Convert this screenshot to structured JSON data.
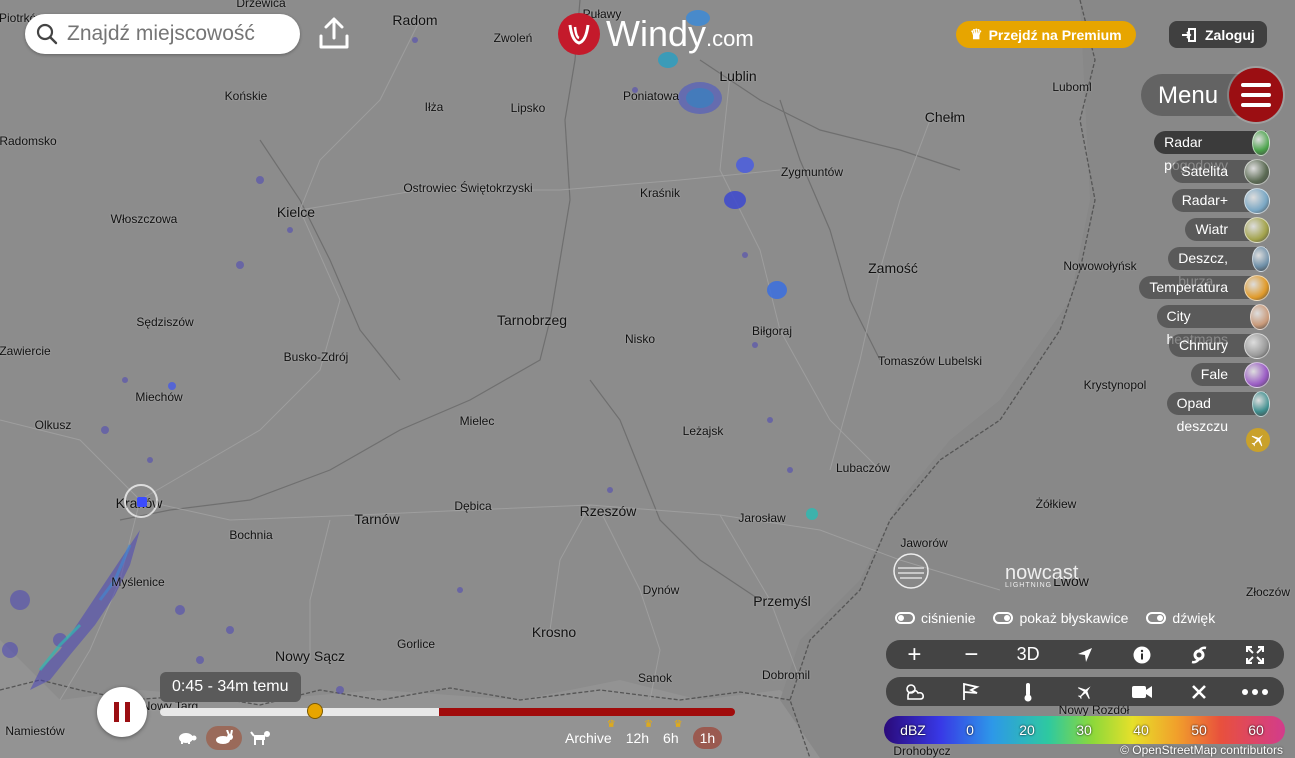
{
  "search": {
    "placeholder": "Znajdź miejscowość"
  },
  "logo": {
    "name": "Windy",
    "domain": ".com"
  },
  "header": {
    "premium_label": "Przejdź na Premium",
    "login_label": "Zaloguj"
  },
  "menu": {
    "label": "Menu"
  },
  "layers": [
    {
      "label": "Radar pogodowy",
      "active": true,
      "color": "#4aa34a"
    },
    {
      "label": "Satelita",
      "active": false,
      "color": "#5c6b54"
    },
    {
      "label": "Radar+",
      "active": false,
      "color": "#7aa7c4"
    },
    {
      "label": "Wiatr",
      "active": false,
      "color": "#a3a34c"
    },
    {
      "label": "Deszcz, burza",
      "active": false,
      "color": "#6e8fa8"
    },
    {
      "label": "Temperatura",
      "active": false,
      "color": "#e09a2a"
    },
    {
      "label": "City heatmaps",
      "active": false,
      "color": "#c99a7a"
    },
    {
      "label": "Chmury",
      "active": false,
      "color": "#9a9a9a"
    },
    {
      "label": "Fale",
      "active": false,
      "color": "#9a5cc4"
    },
    {
      "label": "Opad deszczu",
      "active": false,
      "color": "#3e8e8e"
    }
  ],
  "cities": [
    {
      "name": "Drzewica",
      "size": "small"
    },
    {
      "name": "Radom",
      "size": "big"
    },
    {
      "name": "Puławy",
      "size": "small"
    },
    {
      "name": "Zwoleń",
      "size": "small"
    },
    {
      "name": "Lublin",
      "size": "big"
    },
    {
      "name": "Końskie",
      "size": "small"
    },
    {
      "name": "Iłża",
      "size": "small"
    },
    {
      "name": "Lipsko",
      "size": "small"
    },
    {
      "name": "Poniatowa",
      "size": "small"
    },
    {
      "name": "Luboml",
      "size": "small"
    },
    {
      "name": "Chełm",
      "size": "big"
    },
    {
      "name": "Radomsko",
      "size": "small"
    },
    {
      "name": "Zygmuntów",
      "size": "small"
    },
    {
      "name": "Ostrowiec Świętokrzyski",
      "size": "small"
    },
    {
      "name": "Kraśnik",
      "size": "small"
    },
    {
      "name": "Kielce",
      "size": "big"
    },
    {
      "name": "Włoszczowa",
      "size": "small"
    },
    {
      "name": "Zamość",
      "size": "big"
    },
    {
      "name": "Nowowołyńsk",
      "size": "small"
    },
    {
      "name": "Tarnobrzeg",
      "size": "big"
    },
    {
      "name": "Sędziszów",
      "size": "small"
    },
    {
      "name": "Nisko",
      "size": "small"
    },
    {
      "name": "Biłgoraj",
      "size": "small"
    },
    {
      "name": "Zawiercie",
      "size": "small"
    },
    {
      "name": "Busko-Zdrój",
      "size": "small"
    },
    {
      "name": "Tomaszów Lubelski",
      "size": "small"
    },
    {
      "name": "Krystynopol",
      "size": "small"
    },
    {
      "name": "Miechów",
      "size": "small"
    },
    {
      "name": "Mielec",
      "size": "small"
    },
    {
      "name": "Olkusz",
      "size": "small"
    },
    {
      "name": "Leżajsk",
      "size": "small"
    },
    {
      "name": "Lubaczów",
      "size": "small"
    },
    {
      "name": "Kraków",
      "size": "big"
    },
    {
      "name": "Dębica",
      "size": "small"
    },
    {
      "name": "Rzeszów",
      "size": "big"
    },
    {
      "name": "Żółkiew",
      "size": "small"
    },
    {
      "name": "Tarnów",
      "size": "big"
    },
    {
      "name": "Jarosław",
      "size": "small"
    },
    {
      "name": "Bochnia",
      "size": "small"
    },
    {
      "name": "Jaworów",
      "size": "small"
    },
    {
      "name": "Myślenice",
      "size": "small"
    },
    {
      "name": "Dynów",
      "size": "small"
    },
    {
      "name": "Lwów",
      "size": "big"
    },
    {
      "name": "Złoczów",
      "size": "small"
    },
    {
      "name": "Przemyśl",
      "size": "big"
    },
    {
      "name": "Krosno",
      "size": "big"
    },
    {
      "name": "Gorlice",
      "size": "small"
    },
    {
      "name": "Nowy Sącz",
      "size": "big"
    },
    {
      "name": "Dobromil",
      "size": "small"
    },
    {
      "name": "Sanok",
      "size": "small"
    },
    {
      "name": "Nowy Targ",
      "size": "small"
    },
    {
      "name": "Namiestów",
      "size": "small"
    },
    {
      "name": "Nowy Rozdół",
      "size": "small"
    },
    {
      "name": "Drohobycz",
      "size": "small"
    },
    {
      "name": "Piotrków",
      "size": "small"
    }
  ],
  "toggles": [
    {
      "label": "ciśnienie",
      "on": false
    },
    {
      "label": "pokaż błyskawice",
      "on": true
    },
    {
      "label": "dźwięk",
      "on": true
    }
  ],
  "controls": {
    "zoom_in": "+",
    "zoom_out": "−",
    "three_d": "3D"
  },
  "legend": {
    "unit": "dBZ",
    "ticks": [
      "0",
      "20",
      "30",
      "40",
      "50",
      "60"
    ]
  },
  "attribution": "© OpenStreetMap contributors",
  "timeline": {
    "current_label": "0:45 - 34m temu",
    "progress_fraction": 0.27,
    "ranges": [
      {
        "label": "Archive",
        "premium": true,
        "selected": false
      },
      {
        "label": "12h",
        "premium": true,
        "selected": false
      },
      {
        "label": "6h",
        "premium": true,
        "selected": false
      },
      {
        "label": "1h",
        "premium": false,
        "selected": true
      }
    ]
  },
  "watermark": {
    "nowcast": "nowcast",
    "nowcast_sub": "LIGHTNING"
  }
}
